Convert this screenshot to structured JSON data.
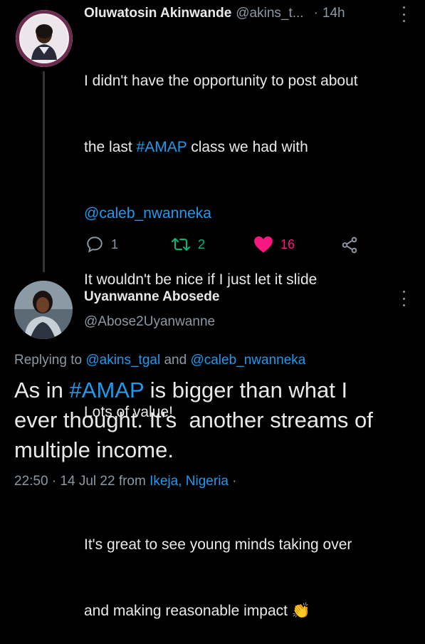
{
  "tweet1": {
    "author_name": "Oluwatosin Akinwande",
    "author_handle": "@akins_t...",
    "separator": "·",
    "time": "14h",
    "lines": [
      "I didn't have the opportunity to post about",
      "the last ",
      "#AMAP",
      " class we had with",
      "@caleb_nwanneka",
      "It wouldn't be nice if I just let it slide",
      "Lots of value!",
      "It's great to see young minds taking over",
      "and making reasonable impact"
    ],
    "emoji": "👏",
    "actions": {
      "reply_count": "1",
      "retweet_count": "2",
      "like_count": "16"
    },
    "colors": {
      "retweet": "#00ba7c",
      "like": "#f91880",
      "link": "#1d9bf0"
    }
  },
  "tweet2": {
    "author_name": "Uyanwanne Abosede",
    "author_handle": "@Abose2Uyanwanne",
    "replying_prefix": "Replying to ",
    "replying_user1": "@akins_tgal",
    "replying_and": " and ",
    "replying_user2": "@caleb_nwanneka",
    "text_pre": "As in ",
    "text_hashtag": "#AMAP",
    "text_line1_rest": " is bigger than what I",
    "text_line2": "ever thought. It's  another streams of",
    "text_line3": "multiple income.",
    "meta_time": "22:50 · 14 Jul 22 from ",
    "meta_location": "Ikeja, Nigeria",
    "meta_tail": " ·"
  }
}
